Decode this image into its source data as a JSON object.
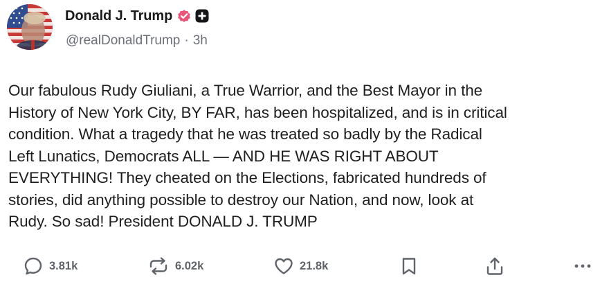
{
  "author": {
    "display_name": "Donald J. Trump",
    "handle": "@realDonaldTrump",
    "separator": "·",
    "time_ago": "3h",
    "avatar_icon": "profile-avatar-flag",
    "verified_icon": "verified-badge-icon",
    "plus_icon": "plus-badge-icon"
  },
  "post": {
    "lines": [
      "Our fabulous Rudy Giuliani, a True Warrior, and the Best Mayor in the",
      "History of New York City, BY FAR, has been hospitalized, and is in critical",
      "condition. What a tragedy that he was treated so badly by the Radical",
      "Left Lunatics, Democrats ALL — AND HE WAS RIGHT ABOUT",
      "EVERYTHING! They cheated on the Elections, fabricated hundreds of",
      "stories, did anything possible to destroy our Nation, and now, look at",
      "Rudy. So sad! President DONALD J. TRUMP"
    ]
  },
  "actions": {
    "reply": {
      "count": "3.81k",
      "icon": "reply-icon"
    },
    "retruth": {
      "count": "6.02k",
      "icon": "retruth-icon"
    },
    "like": {
      "count": "21.8k",
      "icon": "heart-icon"
    },
    "bookmark": {
      "icon": "bookmark-icon"
    },
    "share": {
      "icon": "share-icon"
    },
    "more": {
      "icon": "more-icon"
    }
  },
  "colors": {
    "verified": "#e8567a",
    "text": "#1f1f1f",
    "muted": "#6b6f76",
    "icon": "#5f636a"
  }
}
